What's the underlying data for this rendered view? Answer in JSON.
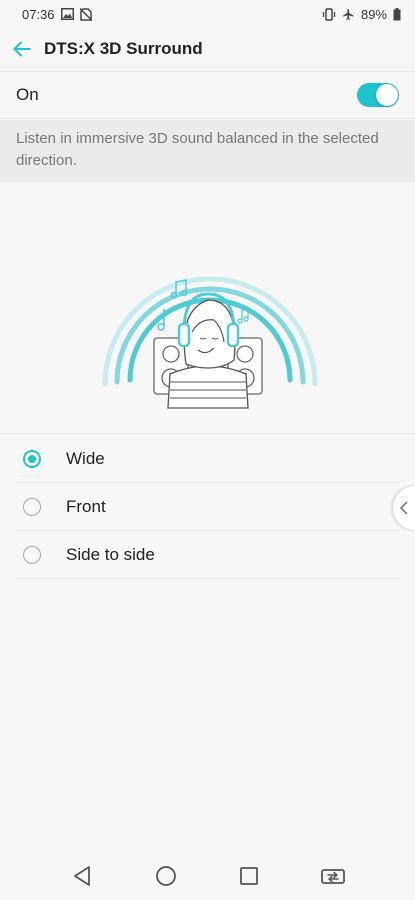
{
  "status_bar": {
    "time": "07:36",
    "battery_percent": "89%",
    "icons_left": [
      "image-icon",
      "no-sim-icon"
    ],
    "icons_right": [
      "vibrate-icon",
      "airplane-icon",
      "battery-icon"
    ]
  },
  "app_bar": {
    "title": "DTS:X 3D Surround",
    "back_icon": "arrow-left-icon"
  },
  "master_switch": {
    "label": "On",
    "checked": true
  },
  "description": "Listen in immersive 3D sound balanced in the selected direction.",
  "options": [
    {
      "label": "Wide",
      "selected": true
    },
    {
      "label": "Front",
      "selected": false
    },
    {
      "label": "Side to side",
      "selected": false
    }
  ],
  "nav_bar": {
    "icons": [
      "back-triangle-icon",
      "home-circle-icon",
      "recents-square-icon",
      "dual-window-icon"
    ]
  },
  "colors": {
    "accent": "#1ec3cf",
    "background": "#f7f7f7",
    "description_bg": "#ebebeb"
  }
}
